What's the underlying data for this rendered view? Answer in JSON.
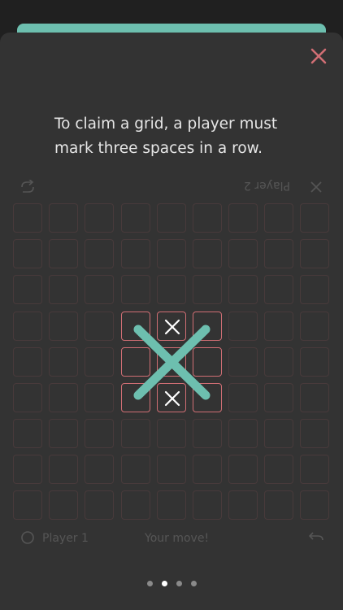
{
  "tutorial": {
    "text": "To claim a grid, a player must mark three spaces in a row."
  },
  "footer": {
    "player1": "Player 1",
    "status": "Your move!"
  },
  "header": {
    "player2": "Player 2"
  },
  "pagination": {
    "count": 4,
    "active_index": 1
  },
  "board": {
    "rows": 9,
    "cols": 9,
    "highlight_block": {
      "row": 3,
      "col": 3
    },
    "x_marks": [
      [
        3,
        4
      ],
      [
        4,
        4
      ],
      [
        5,
        4
      ]
    ],
    "claimed_by_x": true
  },
  "colors": {
    "accent_teal": "#6dbfaf",
    "close_red": "#d06e74",
    "cell_border": "#d06e74",
    "mark_white": "#ffffff"
  },
  "icons": [
    "close-icon",
    "swap-arrow-icon",
    "x-player-icon",
    "circle-player-icon",
    "undo-icon"
  ]
}
